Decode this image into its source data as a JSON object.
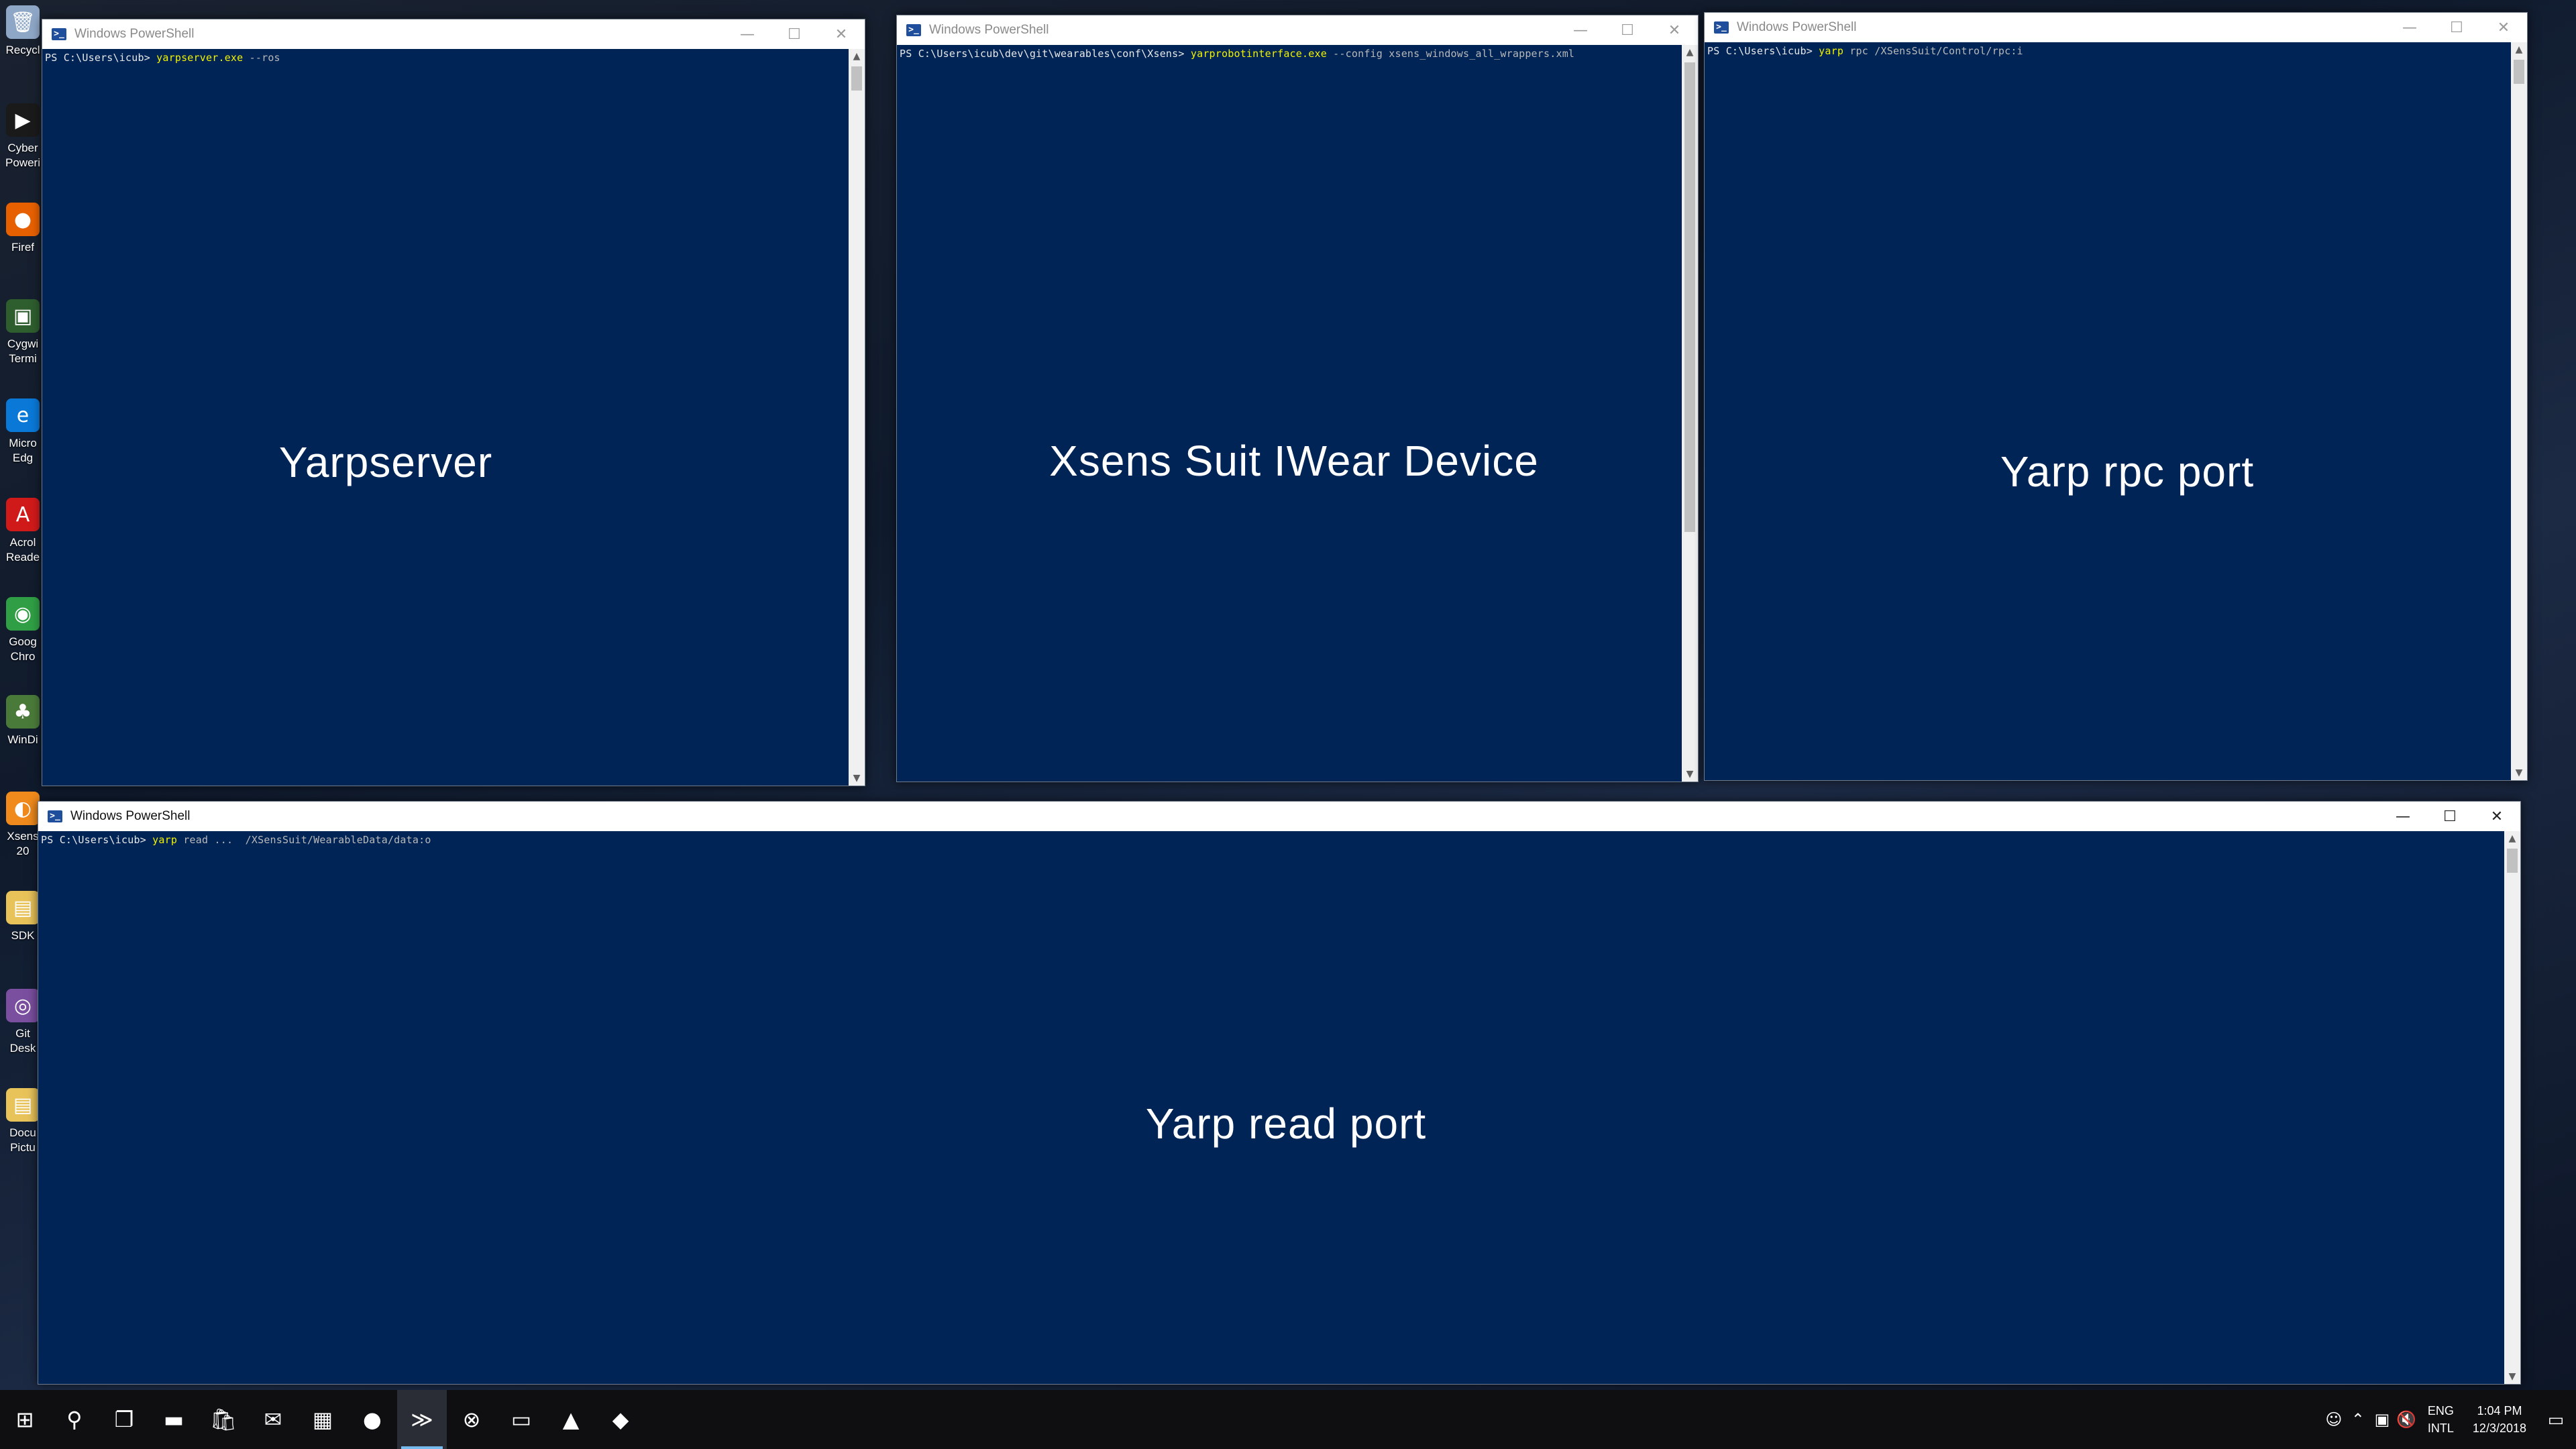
{
  "desktop": {
    "icons": [
      {
        "label": "Recycl",
        "glyph": "🗑",
        "color": "#8fa7c7",
        "icon": "recycle-bin-icon"
      },
      {
        "label": "Cyber\nPoweri",
        "glyph": "▶",
        "color": "#1a1a1a",
        "icon": "cyberlink-powerdvd-icon"
      },
      {
        "label": "Firef",
        "glyph": "●",
        "color": "#e66000",
        "icon": "firefox-icon"
      },
      {
        "label": "Cygwi\nTermi",
        "glyph": "▣",
        "color": "#2e5d2e",
        "icon": "cygwin-terminal-icon"
      },
      {
        "label": "Micro\nEdg",
        "glyph": "e",
        "color": "#0a78d7",
        "icon": "microsoft-edge-icon"
      },
      {
        "label": "Acrol\nReade",
        "glyph": "A",
        "color": "#d01a1a",
        "icon": "acrobat-reader-icon"
      },
      {
        "label": "Goog\nChro",
        "glyph": "◉",
        "color": "#2f9e44",
        "icon": "google-chrome-icon"
      },
      {
        "label": "WinDi",
        "glyph": "♣",
        "color": "#4a7a3a",
        "icon": "windirstat-icon"
      },
      {
        "label": "Xsens\n20",
        "glyph": "◐",
        "color": "#f08a1c",
        "icon": "xsens-icon"
      },
      {
        "label": "SDK",
        "glyph": "▤",
        "color": "#e8c35a",
        "icon": "sdk-folder-icon"
      },
      {
        "label": "Git\nDesk",
        "glyph": "◎",
        "color": "#7b4fa0",
        "icon": "github-desktop-icon"
      },
      {
        "label": "Docu\nPictu",
        "glyph": "▤",
        "color": "#e8c35a",
        "icon": "documents-folder-icon"
      }
    ]
  },
  "windows": {
    "yarpserver": {
      "title": "Windows PowerShell",
      "prompt": "PS C:\\Users\\icub> ",
      "exe": "yarpserver.exe",
      "args": " --ros",
      "overlay": "Yarpserver"
    },
    "xsens": {
      "title": "Windows PowerShell",
      "prompt": "PS C:\\Users\\icub\\dev\\git\\wearables\\conf\\Xsens> ",
      "exe": "yarprobotinterface.exe",
      "args": " --config xsens_windows_all_wrappers.xml",
      "overlay": "Xsens Suit IWear Device"
    },
    "rpc": {
      "title": "Windows PowerShell",
      "prompt": "PS C:\\Users\\icub> ",
      "exe": "yarp",
      "args": " rpc /XSensSuit/Control/rpc:i",
      "overlay": "Yarp rpc port"
    },
    "read": {
      "title": "Windows PowerShell",
      "prompt": "PS C:\\Users\\icub> ",
      "exe": "yarp",
      "args": " read ...  /XSensSuit/WearableData/data:o",
      "overlay": "Yarp read port"
    },
    "controls": {
      "minimize": "—",
      "maximize": "☐",
      "close": "✕"
    },
    "scroll_up": "▲",
    "scroll_down": "▼"
  },
  "taskbar": {
    "start": "⊞",
    "search": "⚲",
    "taskview": "❐",
    "apps": [
      {
        "glyph": "▬",
        "icon": "file-explorer-icon",
        "active": false
      },
      {
        "glyph": "🛍",
        "icon": "store-icon",
        "active": false
      },
      {
        "glyph": "✉",
        "icon": "mail-icon",
        "active": false
      },
      {
        "glyph": "▦",
        "icon": "calculator-app-icon",
        "active": false
      },
      {
        "glyph": "●",
        "icon": "firefox-taskbar-icon",
        "active": false
      },
      {
        "glyph": "≫",
        "icon": "powershell-taskbar-icon",
        "active": true
      },
      {
        "glyph": "⊗",
        "icon": "xbox-icon",
        "active": false
      },
      {
        "glyph": "▭",
        "icon": "terminal-window-icon",
        "active": false
      },
      {
        "glyph": "▲",
        "icon": "mvn-analyze-icon",
        "active": false
      },
      {
        "glyph": "◆",
        "icon": "git-icon",
        "active": false
      }
    ],
    "tray": {
      "people": "☺",
      "chevron": "⌃",
      "network": "▣",
      "volume": "🔇",
      "lang_top": "ENG",
      "lang_bottom": "INTL",
      "time": "1:04 PM",
      "date": "12/3/2018",
      "notification": "▭"
    }
  }
}
